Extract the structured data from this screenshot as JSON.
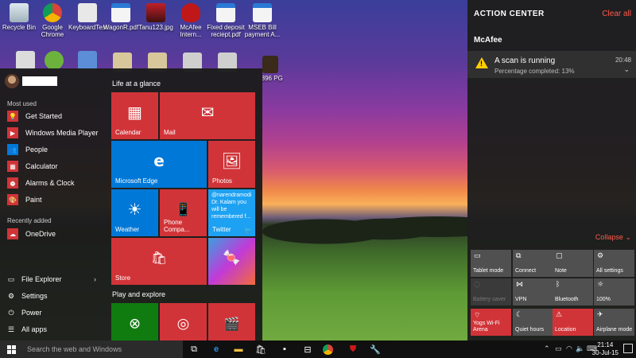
{
  "desktop": {
    "icons": [
      {
        "label": "Recycle Bin"
      },
      {
        "label": "Google Chrome"
      },
      {
        "label": "KeyboardTest"
      },
      {
        "label": "WagonR.pdf"
      },
      {
        "label": "Tanu123.jpg"
      },
      {
        "label": "McAfee Intern..."
      },
      {
        "label": "Fixed deposit reciept.pdf"
      },
      {
        "label": "MSEB Bill payment A..."
      }
    ],
    "partial_label": "5896 PG"
  },
  "start_menu": {
    "section_most_used": "Most used",
    "most_used": [
      {
        "label": "Get Started",
        "icon": "lightbulb-icon"
      },
      {
        "label": "Windows Media Player",
        "icon": "media-player-icon"
      },
      {
        "label": "People",
        "icon": "people-icon"
      },
      {
        "label": "Calculator",
        "icon": "calculator-icon"
      },
      {
        "label": "Alarms & Clock",
        "icon": "alarm-icon"
      },
      {
        "label": "Paint",
        "icon": "paint-icon"
      }
    ],
    "section_recently_added": "Recently added",
    "recently_added": [
      {
        "label": "OneDrive",
        "icon": "onedrive-icon"
      }
    ],
    "bottom": [
      {
        "label": "File Explorer",
        "icon": "folder-icon",
        "chevron": "›"
      },
      {
        "label": "Settings",
        "icon": "gear-icon"
      },
      {
        "label": "Power",
        "icon": "power-icon"
      },
      {
        "label": "All apps",
        "icon": "list-icon"
      }
    ],
    "tiles_heading_1": "Life at a glance",
    "tiles_heading_2": "Play and explore",
    "tiles": {
      "calendar": "Calendar",
      "mail": "Mail",
      "edge": "Microsoft Edge",
      "photos": "Photos",
      "weather": "Weather",
      "phone": "Phone Compa...",
      "twitter": "Twitter",
      "twitter_text": "@narendramodi Dr. Kalam you will be remembered f...",
      "store": "Store"
    },
    "colors": {
      "tile_red": "#d13438",
      "tile_blue": "#0078d7",
      "tile_green": "#107c10"
    }
  },
  "action_center": {
    "title": "ACTION CENTER",
    "clear_all": "Clear all",
    "app": "McAfee",
    "notification": {
      "title": "A scan is running",
      "subtitle": "Percentage completed: 13%",
      "time": "20:48"
    },
    "collapse": "Collapse",
    "quick_actions": [
      {
        "label": "Tablet mode",
        "icon": "tablet-icon",
        "state": "off"
      },
      {
        "label": "Connect",
        "icon": "connect-icon",
        "state": "off"
      },
      {
        "label": "Note",
        "icon": "note-icon",
        "state": "off"
      },
      {
        "label": "All settings",
        "icon": "gear-icon",
        "state": "off"
      },
      {
        "label": "Battery saver",
        "icon": "battery-icon",
        "state": "disabled"
      },
      {
        "label": "VPN",
        "icon": "vpn-icon",
        "state": "off"
      },
      {
        "label": "Bluetooth",
        "icon": "bluetooth-icon",
        "state": "off"
      },
      {
        "label": "100%",
        "icon": "brightness-icon",
        "state": "off"
      },
      {
        "label": "Yogs Wi-Fi Arena",
        "icon": "wifi-icon",
        "state": "on"
      },
      {
        "label": "Quiet hours",
        "icon": "moon-icon",
        "state": "off"
      },
      {
        "label": "Location",
        "icon": "location-icon",
        "state": "on"
      },
      {
        "label": "Airplane mode",
        "icon": "airplane-icon",
        "state": "off"
      }
    ]
  },
  "taskbar": {
    "search_placeholder": "Search the web and Windows",
    "time": "21:14",
    "date": "30-Jul-15"
  }
}
